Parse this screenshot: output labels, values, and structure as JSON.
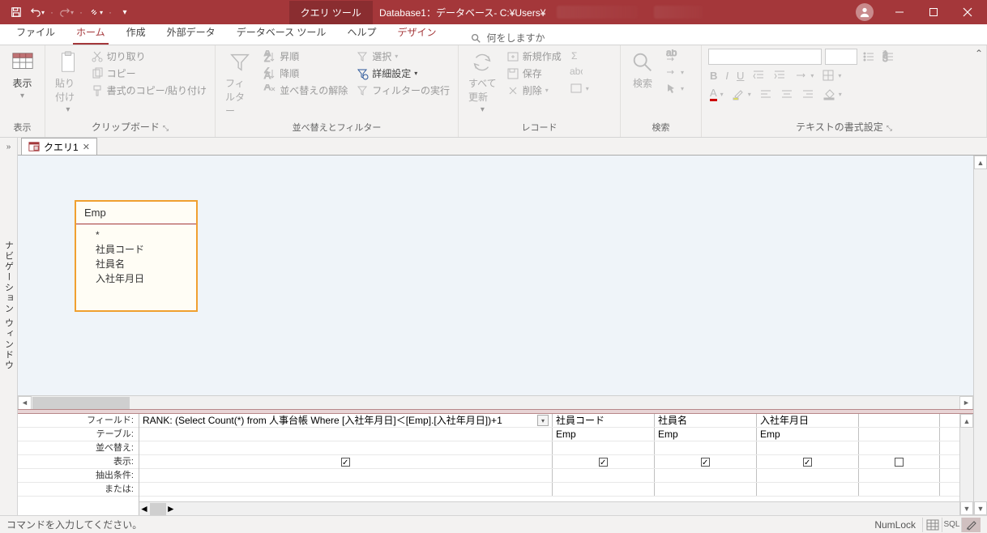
{
  "titlebar": {
    "tool_tab": "クエリ ツール",
    "app_title": "Database1：データベース- C:¥Users¥"
  },
  "ribbon_tabs": {
    "file": "ファイル",
    "home": "ホーム",
    "create": "作成",
    "external": "外部データ",
    "dbtools": "データベース ツール",
    "help": "ヘルプ",
    "design": "デザイン",
    "search_placeholder": "何をしますか"
  },
  "ribbon": {
    "view": {
      "label": "表示",
      "btn": "表示"
    },
    "clipboard": {
      "label": "クリップボード",
      "paste": "貼り付け",
      "cut": "切り取り",
      "copy": "コピー",
      "format": "書式のコピー/貼り付け"
    },
    "sortfilter": {
      "label": "並べ替えとフィルター",
      "filter": "フィルター",
      "asc": "昇順",
      "desc": "降順",
      "clear": "並べ替えの解除",
      "selection": "選択",
      "advanced": "詳細設定",
      "toggle": "フィルターの実行"
    },
    "records": {
      "label": "レコード",
      "refresh": "すべて\n更新",
      "new_": "新規作成",
      "save": "保存",
      "delete": "削除"
    },
    "find": {
      "label": "検索",
      "find": "検索"
    },
    "format": {
      "label": "テキストの書式設定"
    }
  },
  "nav": {
    "label": "ナビゲーション ウィンドウ"
  },
  "doc": {
    "tab_name": "クエリ1",
    "table": {
      "name": "Emp",
      "fields": [
        "*",
        "社員コード",
        "社員名",
        "入社年月日"
      ]
    }
  },
  "grid": {
    "labels": {
      "field": "フィールド:",
      "table": "テーブル:",
      "sort": "並べ替え:",
      "show": "表示:",
      "criteria": "抽出条件:",
      "or": "または:"
    },
    "cols": [
      {
        "field": "RANK: (Select Count(*) from 人事台帳 Where [入社年月日]＜[Emp].[入社年月日])+1",
        "table": "",
        "show": true,
        "hasdd": true
      },
      {
        "field": "社員コード",
        "table": "Emp",
        "show": true
      },
      {
        "field": "社員名",
        "table": "Emp",
        "show": true
      },
      {
        "field": "入社年月日",
        "table": "Emp",
        "show": true
      },
      {
        "field": "",
        "table": "",
        "show": false
      }
    ]
  },
  "statusbar": {
    "msg": "コマンドを入力してください。",
    "numlock": "NumLock",
    "sql": "SQL"
  }
}
